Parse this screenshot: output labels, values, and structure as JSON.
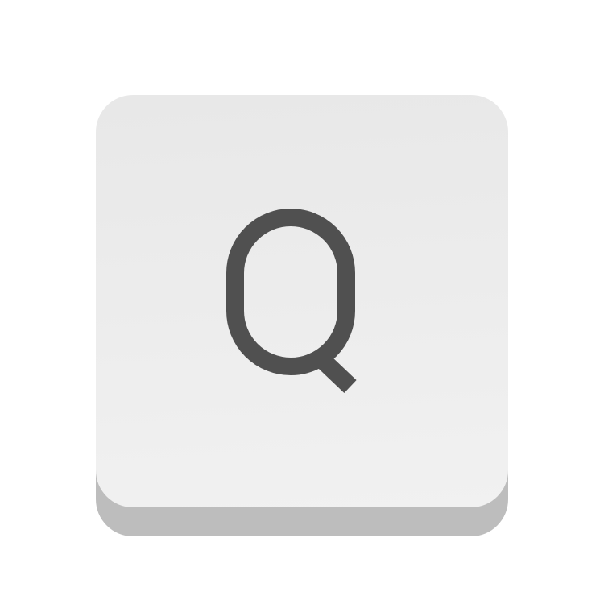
{
  "key": {
    "label": "Q",
    "face_color": "#ececec",
    "base_color": "#bdbdbd",
    "glyph_color": "#505050",
    "icon": "keyboard-key-q"
  }
}
